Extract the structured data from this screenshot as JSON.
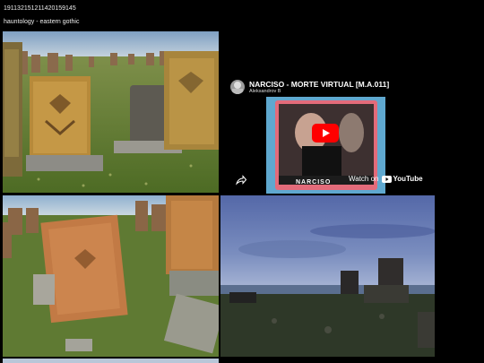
{
  "header": {
    "post_id": "191132151211420159145",
    "tags": "hauntology - eastern gothic"
  },
  "video": {
    "title": "NARCISO - MORTE VIRTUAL [M.A.011]",
    "channel": "Aleksandrov B",
    "watch_on": "Watch on",
    "platform": "YouTube",
    "thumb_band_text": "NARCISO"
  },
  "images": [
    {
      "alt": "photo-khachkars-field-1"
    },
    {
      "alt": "photo-khachkars-field-2"
    },
    {
      "alt": "photo-lake-dusk"
    }
  ]
}
